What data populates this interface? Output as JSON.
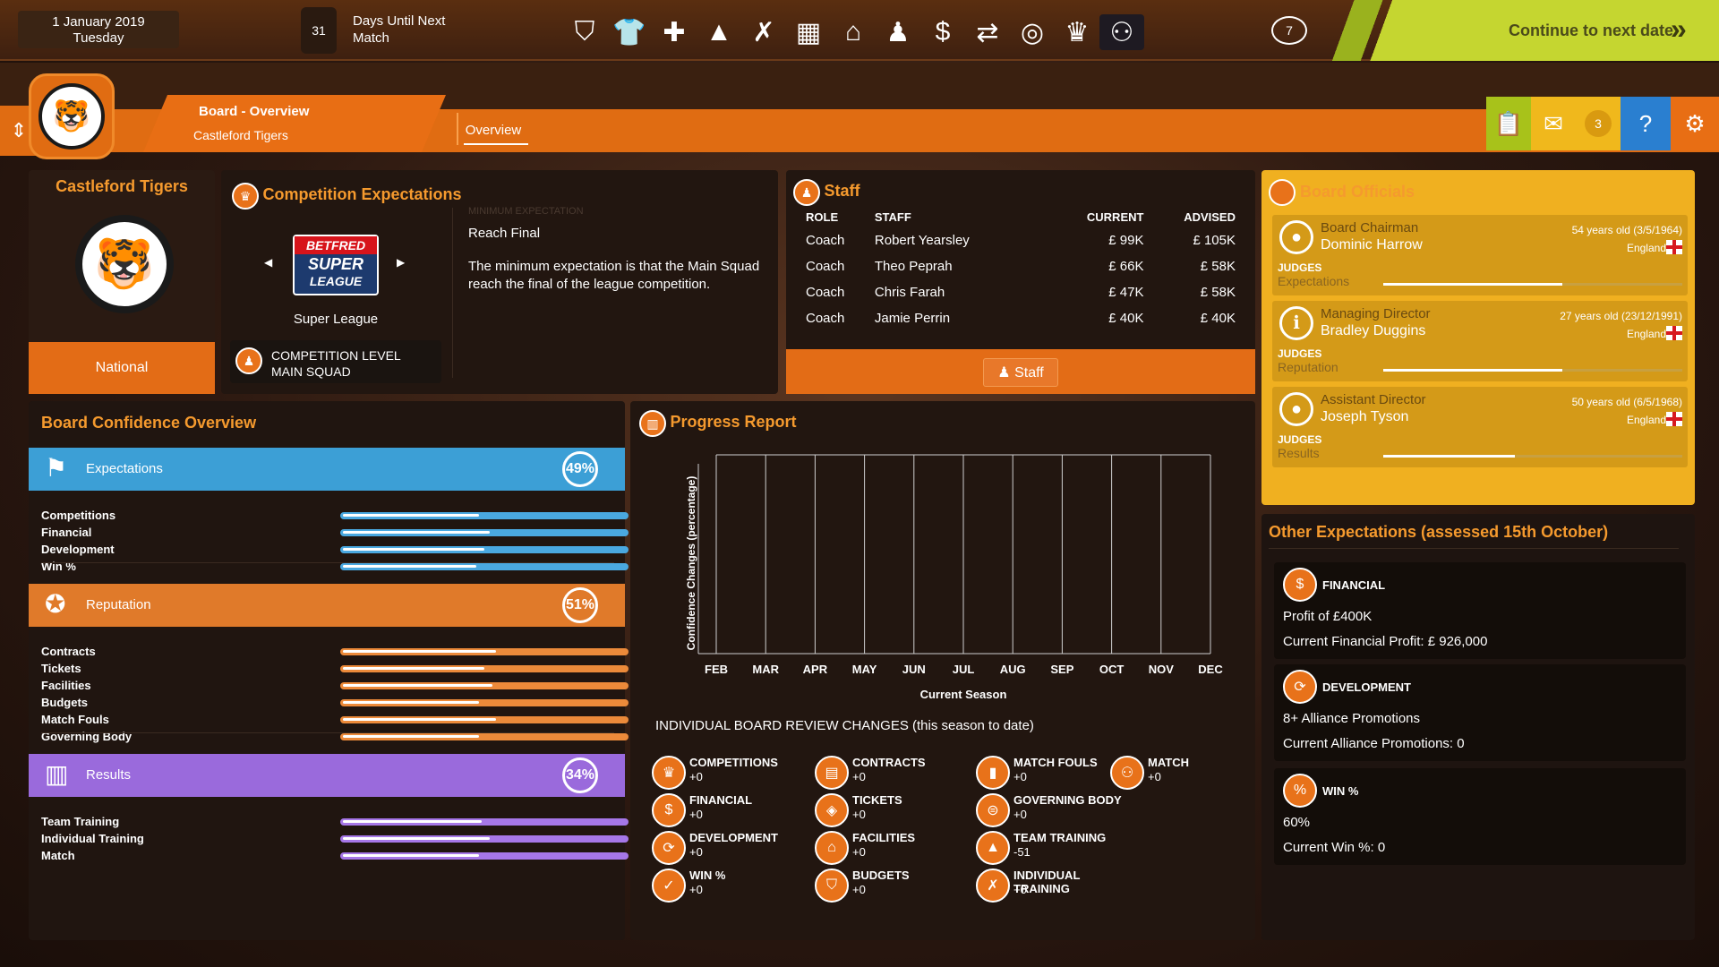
{
  "topbar": {
    "date": "1 January 2019",
    "day": "Tuesday",
    "calendar_number": "31",
    "days_label_line1": "Days Until Next",
    "days_label_line2": "Match",
    "reset_number": "7",
    "continue_label": "Continue to next date",
    "nav_icons": [
      "shield-icon",
      "kit-icon",
      "medical-icon",
      "cone-icon",
      "tactics-icon",
      "calendar-icon",
      "home-icon",
      "squad-icon",
      "finance-icon",
      "transfer-icon",
      "target-icon",
      "trophy-icon",
      "board-icon"
    ]
  },
  "header": {
    "breadcrumb_title": "Board - Overview",
    "breadcrumb_sub": "Castleford Tigers",
    "tab": "Overview",
    "notification_count": "3"
  },
  "team": {
    "name": "Castleford Tigers",
    "level": "National"
  },
  "competition": {
    "title": "Competition Expectations",
    "league_logo_top": "BETFRED",
    "league_logo_line1": "SUPER",
    "league_logo_line2": "LEAGUE",
    "league_name": "Super League",
    "level_label": "COMPETITION LEVEL",
    "level_value": "MAIN SQUAD",
    "min_label": "MINIMUM EXPECTATION",
    "min_value": "Reach Final",
    "min_desc": "The minimum expectation is that the Main Squad reach the final of the league competition."
  },
  "staff": {
    "title": "Staff",
    "headers": {
      "role": "ROLE",
      "staff": "STAFF",
      "current": "CURRENT",
      "advised": "ADVISED"
    },
    "rows": [
      {
        "role": "Coach",
        "name": "Robert Yearsley",
        "current": "£ 99K",
        "advised": "£ 105K"
      },
      {
        "role": "Coach",
        "name": "Theo Peprah",
        "current": "£ 66K",
        "advised": "£ 58K"
      },
      {
        "role": "Coach",
        "name": "Chris Farah",
        "current": "£ 47K",
        "advised": "£ 58K"
      },
      {
        "role": "Coach",
        "name": "Jamie Perrin",
        "current": "£ 40K",
        "advised": "£ 40K"
      }
    ],
    "button": "Staff"
  },
  "officials": {
    "title": "Board Officials",
    "judges_label": "JUDGES",
    "items": [
      {
        "role": "Board Chairman",
        "name": "Dominic Harrow",
        "age": "54 years old (3/5/1964)",
        "country": "England",
        "judges": "Expectations",
        "level": 0.6
      },
      {
        "role": "Managing Director",
        "name": "Bradley Duggins",
        "age": "27 years old (23/12/1991)",
        "country": "England",
        "judges": "Reputation",
        "level": 0.6
      },
      {
        "role": "Assistant Director",
        "name": "Joseph Tyson",
        "age": "50 years old (6/5/1968)",
        "country": "England",
        "judges": "Results",
        "level": 0.44
      }
    ]
  },
  "confidence": {
    "title": "Board Confidence Overview",
    "categories": [
      {
        "label": "Expectations",
        "pct": "49%",
        "color": "#3c9fd6",
        "track": "#4aa8e0",
        "subs": [
          {
            "label": "Competitions",
            "level": 0.48
          },
          {
            "label": "Financial",
            "level": 0.52
          },
          {
            "label": "Development",
            "level": 0.5
          },
          {
            "label": "Win %",
            "level": 0.47
          }
        ]
      },
      {
        "label": "Reputation",
        "pct": "51%",
        "color": "#e07a2a",
        "track": "#ec8a3a",
        "subs": [
          {
            "label": "Contracts",
            "level": 0.54
          },
          {
            "label": "Tickets",
            "level": 0.5
          },
          {
            "label": "Facilities",
            "level": 0.53
          },
          {
            "label": "Budgets",
            "level": 0.48
          },
          {
            "label": "Match Fouls",
            "level": 0.54
          },
          {
            "label": "Governing Body",
            "level": 0.48
          }
        ]
      },
      {
        "label": "Results",
        "pct": "34%",
        "color": "#9a6adc",
        "track": "#a677e8",
        "subs": [
          {
            "label": "Team Training",
            "level": 0.49
          },
          {
            "label": "Individual Training",
            "level": 0.52
          },
          {
            "label": "Match",
            "level": 0.48
          }
        ]
      }
    ]
  },
  "progress": {
    "title": "Progress Report",
    "review_title": "INDIVIDUAL BOARD REVIEW CHANGES (this season to date)",
    "review_items": [
      {
        "label": "COMPETITIONS",
        "value": "+0",
        "icon": "trophy-icon"
      },
      {
        "label": "FINANCIAL",
        "value": "+0",
        "icon": "money-bag-icon"
      },
      {
        "label": "DEVELOPMENT",
        "value": "+0",
        "icon": "development-icon"
      },
      {
        "label": "WIN %",
        "value": "+0",
        "icon": "check-icon"
      },
      {
        "label": "CONTRACTS",
        "value": "+0",
        "icon": "contract-icon"
      },
      {
        "label": "TICKETS",
        "value": "+0",
        "icon": "ticket-icon"
      },
      {
        "label": "FACILITIES",
        "value": "+0",
        "icon": "facilities-icon"
      },
      {
        "label": "BUDGETS",
        "value": "+0",
        "icon": "budget-icon"
      },
      {
        "label": "MATCH FOULS",
        "value": "+0",
        "icon": "card-icon"
      },
      {
        "label": "GOVERNING BODY",
        "value": "+0",
        "icon": "governing-icon"
      },
      {
        "label": "TEAM TRAINING",
        "value": "-51",
        "icon": "cone-icon"
      },
      {
        "label": "INDIVIDUAL TRAINING",
        "value": "+0",
        "icon": "tactics-icon"
      },
      {
        "label": "MATCH",
        "value": "+0",
        "icon": "match-icon"
      }
    ]
  },
  "chart_data": {
    "type": "line",
    "categories": [
      "FEB",
      "MAR",
      "APR",
      "MAY",
      "JUN",
      "JUL",
      "AUG",
      "SEP",
      "OCT",
      "NOV",
      "DEC"
    ],
    "series": [],
    "xlabel": "Current Season",
    "ylabel": "Confidence Changes (percentage)",
    "grid": true
  },
  "other": {
    "title": "Other Expectations (assessed 15th October)",
    "cards": [
      {
        "label": "FINANCIAL",
        "line1": "Profit of £400K",
        "line2": "Current Financial Profit: £ 926,000",
        "icon": "money-bag-icon"
      },
      {
        "label": "DEVELOPMENT",
        "line1": "8+ Alliance Promotions",
        "line2": "Current Alliance Promotions: 0",
        "icon": "development-icon"
      },
      {
        "label": "WIN %",
        "line1": "60%",
        "line2": "Current Win %: 0",
        "icon": "percent-icon"
      }
    ]
  }
}
